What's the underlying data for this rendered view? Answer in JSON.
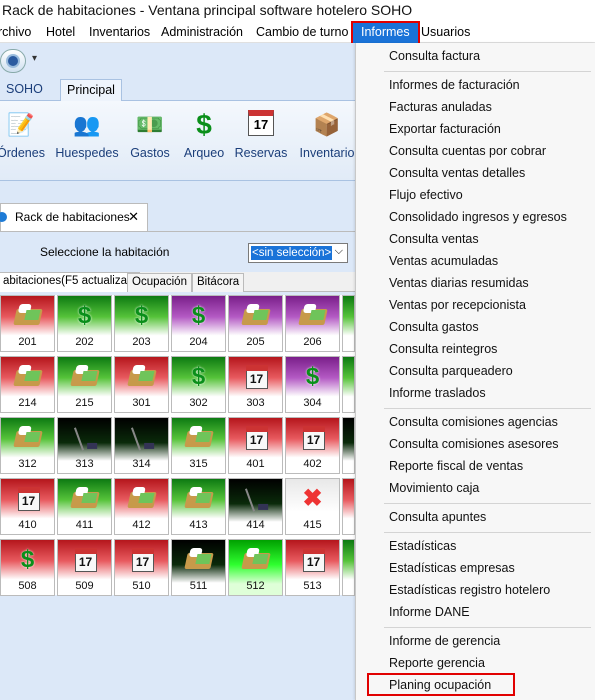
{
  "window": {
    "title": "Rack de habitaciones  - Ventana principal software hotelero SOHO"
  },
  "menubar": {
    "items": [
      "rchivo",
      "Hotel",
      "Inventarios",
      "Administración",
      "Cambio de turno",
      "Informes",
      "Usuarios"
    ],
    "active": "Informes"
  },
  "ribbon": {
    "tabs": [
      "SOHO",
      "Principal"
    ],
    "selected_tab": "Principal",
    "buttons": [
      {
        "label": "Órdenes",
        "icon": "orders-icon"
      },
      {
        "label": "Huespedes",
        "icon": "guests-icon"
      },
      {
        "label": "Gastos",
        "icon": "money-icon"
      },
      {
        "label": "Arqueo",
        "icon": "dollar-icon"
      },
      {
        "label": "Reservas",
        "icon": "calendar-icon"
      },
      {
        "label": "Inventario",
        "icon": "box-icon"
      }
    ]
  },
  "document": {
    "tab_label": "Rack de habitaciones",
    "close": "✕"
  },
  "selector": {
    "label": "Seleccione la habitación",
    "value": "<sin selección>"
  },
  "subtabs": [
    "abitaciones(F5 actualizar)",
    "Ocupación",
    "Bitácora"
  ],
  "rooms": [
    [
      {
        "n": "201",
        "i": "bed",
        "bg": "red"
      },
      {
        "n": "202",
        "i": "dollar",
        "bg": "green"
      },
      {
        "n": "203",
        "i": "dollar",
        "bg": "green"
      },
      {
        "n": "204",
        "i": "dollar",
        "bg": "purple"
      },
      {
        "n": "205",
        "i": "bed",
        "bg": "purple"
      },
      {
        "n": "206",
        "i": "bed",
        "bg": "purple"
      }
    ],
    [
      {
        "n": "214",
        "i": "bed",
        "bg": "red"
      },
      {
        "n": "215",
        "i": "bed",
        "bg": "green"
      },
      {
        "n": "301",
        "i": "bed",
        "bg": "red"
      },
      {
        "n": "302",
        "i": "dollar",
        "bg": "green"
      },
      {
        "n": "303",
        "i": "cal",
        "bg": "red"
      },
      {
        "n": "304",
        "i": "dollar",
        "bg": "purple"
      }
    ],
    [
      {
        "n": "312",
        "i": "bed",
        "bg": "green"
      },
      {
        "n": "313",
        "i": "broom",
        "bg": "black"
      },
      {
        "n": "314",
        "i": "broom",
        "bg": "black"
      },
      {
        "n": "315",
        "i": "bed",
        "bg": "green"
      },
      {
        "n": "401",
        "i": "cal",
        "bg": "red"
      },
      {
        "n": "402",
        "i": "cal",
        "bg": "red"
      }
    ],
    [
      {
        "n": "410",
        "i": "cal",
        "bg": "red"
      },
      {
        "n": "411",
        "i": "bed",
        "bg": "green"
      },
      {
        "n": "412",
        "i": "bed",
        "bg": "red"
      },
      {
        "n": "413",
        "i": "bed",
        "bg": "green"
      },
      {
        "n": "414",
        "i": "broom",
        "bg": "black"
      },
      {
        "n": "415",
        "i": "x",
        "bg": "gray"
      }
    ],
    [
      {
        "n": "508",
        "i": "dollar",
        "bg": "red"
      },
      {
        "n": "509",
        "i": "cal",
        "bg": "red"
      },
      {
        "n": "510",
        "i": "cal",
        "bg": "red"
      },
      {
        "n": "511",
        "i": "bed",
        "bg": "black"
      },
      {
        "n": "512",
        "i": "bed",
        "bg": "lime"
      },
      {
        "n": "513",
        "i": "cal",
        "bg": "red"
      }
    ]
  ],
  "informes_menu": [
    {
      "label": "Consulta factura"
    },
    {
      "sep": true
    },
    {
      "label": "Informes de facturación"
    },
    {
      "label": "Facturas anuladas"
    },
    {
      "label": "Exportar facturación"
    },
    {
      "label": "Consulta cuentas por cobrar"
    },
    {
      "label": "Consulta ventas detalles"
    },
    {
      "label": "Flujo efectivo"
    },
    {
      "label": "Consolidado ingresos y egresos"
    },
    {
      "label": "Consulta ventas"
    },
    {
      "label": "Ventas acumuladas"
    },
    {
      "label": "Ventas diarias resumidas"
    },
    {
      "label": "Ventas por recepcionista"
    },
    {
      "label": "Consulta gastos"
    },
    {
      "label": "Consulta reintegros"
    },
    {
      "label": "Consulta parqueadero"
    },
    {
      "label": "Informe traslados"
    },
    {
      "sep": true
    },
    {
      "label": "Consulta comisiones agencias"
    },
    {
      "label": "Consulta comisiones asesores"
    },
    {
      "label": "Reporte fiscal de ventas"
    },
    {
      "label": "Movimiento caja"
    },
    {
      "sep": true
    },
    {
      "label": "Consulta apuntes"
    },
    {
      "sep": true
    },
    {
      "label": "Estadísticas"
    },
    {
      "label": "Estadísticas empresas"
    },
    {
      "label": "Estadísticas registro hotelero"
    },
    {
      "label": "Informe DANE"
    },
    {
      "sep": true
    },
    {
      "label": "Informe de gerencia"
    },
    {
      "label": "Reporte gerencia"
    },
    {
      "label": "Planing ocupación",
      "highlight": true
    }
  ],
  "colors": {
    "highlight_box": "#e10000",
    "menu_active": "#1a73d8"
  }
}
